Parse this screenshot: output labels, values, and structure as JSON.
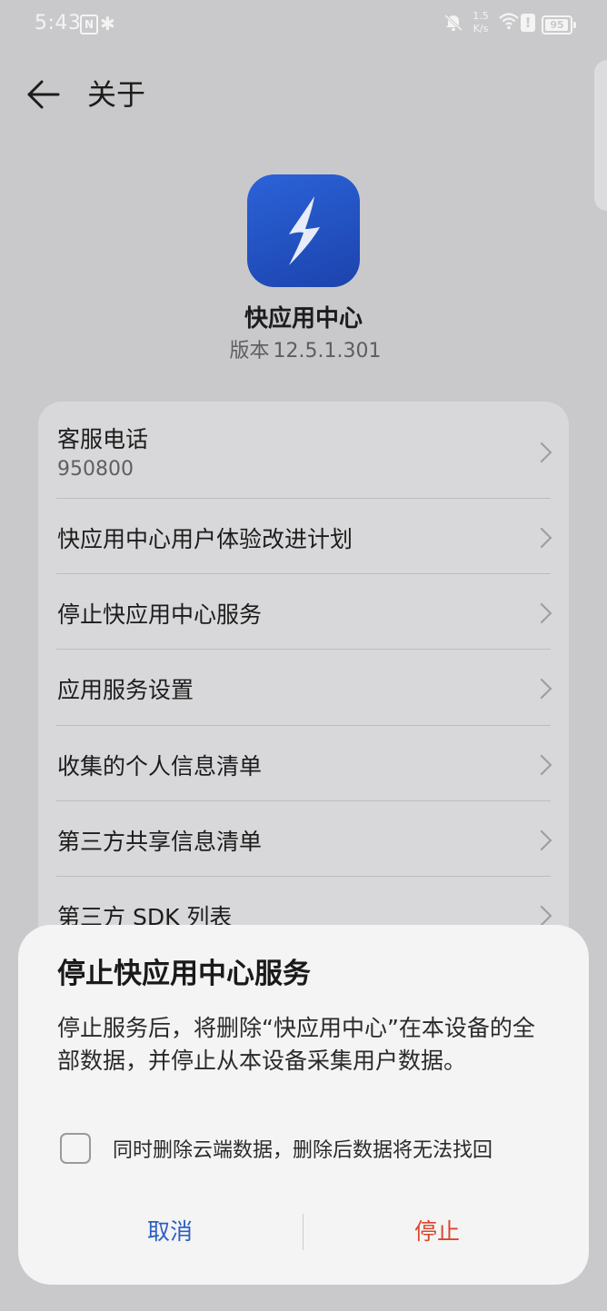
{
  "status_bar": {
    "time": "5:43",
    "nfc": "N",
    "bluetooth": "✱",
    "net_speed_value": "1.5",
    "net_speed_unit": "K/s",
    "alert": "!",
    "battery": "95",
    "battery_level": 0.95
  },
  "header": {
    "title": "关于"
  },
  "app": {
    "name": "快应用中心",
    "version_label": "版本",
    "version": "12.5.1.301"
  },
  "settings": [
    {
      "label": "客服电话",
      "sub": "950800"
    },
    {
      "label": "快应用中心用户体验改进计划"
    },
    {
      "label": "停止快应用中心服务"
    },
    {
      "label": "应用服务设置"
    },
    {
      "label": "收集的个人信息清单"
    },
    {
      "label": "第三方共享信息清单"
    },
    {
      "label": "第三方 SDK 列表"
    }
  ],
  "dialog": {
    "title": "停止快应用中心服务",
    "message": "停止服务后，将删除“快应用中心”在本设备的全部数据，并停止从本设备采集用户数据。",
    "checkbox_label": "同时删除云端数据，删除后数据将无法找回",
    "checkbox_checked": false,
    "cancel": "取消",
    "confirm": "停止"
  },
  "colors": {
    "accent": "#2d5fc4",
    "danger": "#d9462d",
    "app_icon": "#2352c4"
  }
}
